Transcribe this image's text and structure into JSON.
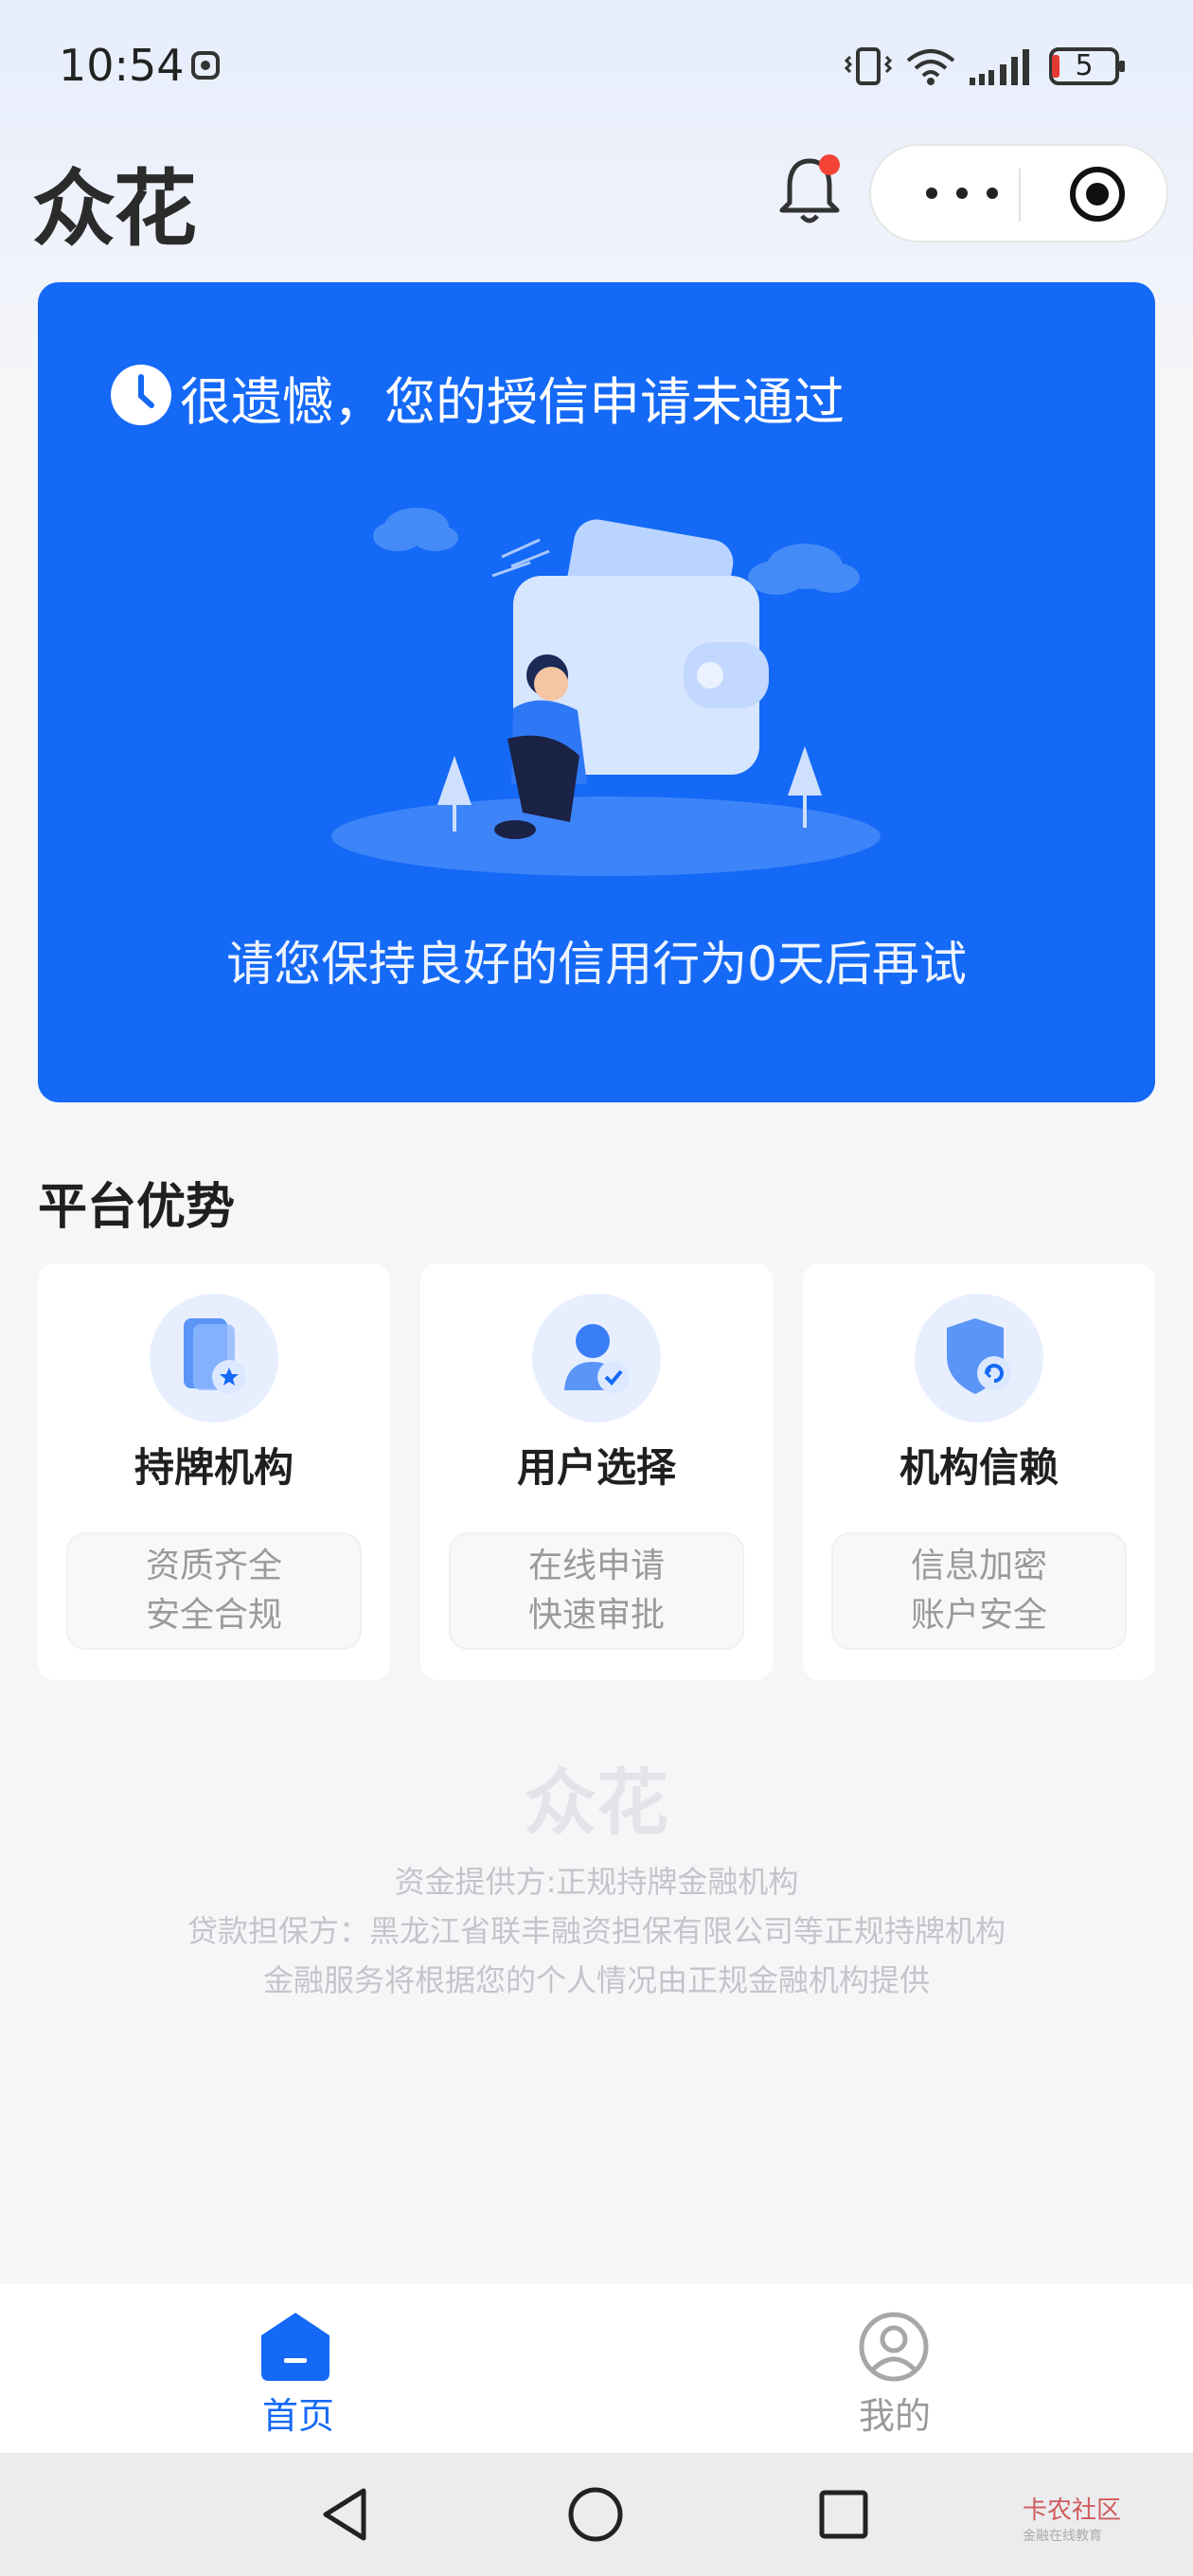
{
  "status_bar": {
    "time": "10:54",
    "battery_level": "5"
  },
  "header": {
    "logo": "众花"
  },
  "status_card": {
    "title": "很遗憾，您的授信申请未通过",
    "message": "请您保持良好的信用行为0天后再试",
    "background_color": "#1469F6"
  },
  "section": {
    "title": "平台优势",
    "features": [
      {
        "title": "持牌机构",
        "desc_line1": "资质齐全",
        "desc_line2": "安全合规",
        "icon": "licensed-institution-icon"
      },
      {
        "title": "用户选择",
        "desc_line1": "在线申请",
        "desc_line2": "快速审批",
        "icon": "user-choice-icon"
      },
      {
        "title": "机构信赖",
        "desc_line1": "信息加密",
        "desc_line2": "账户安全",
        "icon": "shield-trust-icon"
      }
    ]
  },
  "footer": {
    "logo": "众花",
    "line1": "资金提供方:正规持牌金融机构",
    "line2": "贷款担保方：黑龙江省联丰融资担保有限公司等正规持牌机构",
    "line3": "金融服务将根据您的个人情况由正规金融机构提供"
  },
  "tab_bar": {
    "tabs": [
      {
        "label": "首页",
        "icon": "home-icon",
        "active": true
      },
      {
        "label": "我的",
        "icon": "profile-icon",
        "active": false
      }
    ]
  },
  "watermark": {
    "text": "卡农社区",
    "subtext": "金融在线教育"
  },
  "colors": {
    "accent": "#1469F6",
    "notification_dot": "#F44336"
  }
}
